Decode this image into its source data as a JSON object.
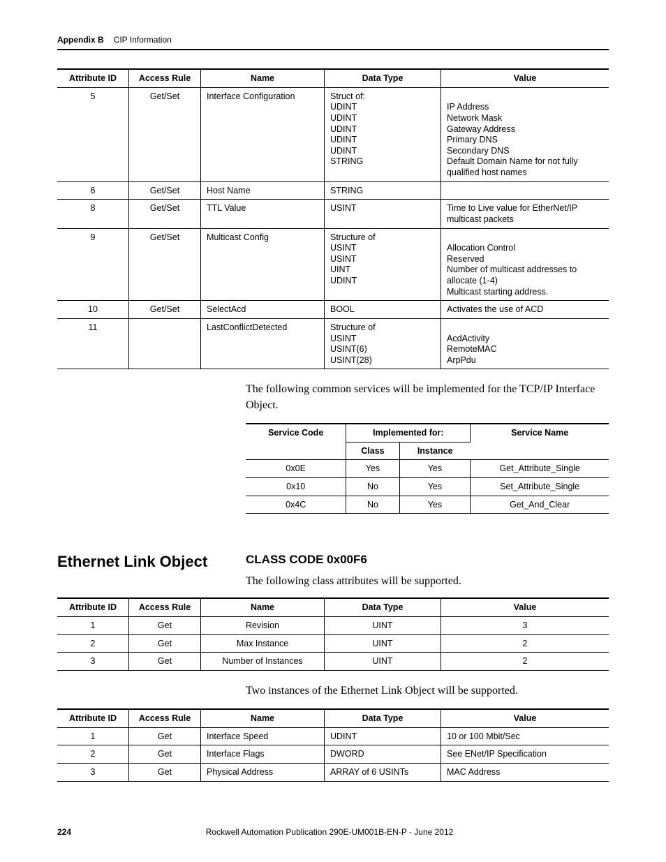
{
  "header": {
    "appendix": "Appendix B",
    "title": "CIP Information"
  },
  "table1": {
    "headers": [
      "Attribute ID",
      "Access Rule",
      "Name",
      "Data Type",
      "Value"
    ],
    "rows": [
      {
        "id": "5",
        "access": "Get/Set",
        "name": "Interface Configuration",
        "dtype": "Struct of:\nUDINT\nUDINT\nUDINT\nUDINT\nUDINT\nSTRING",
        "value": "\nIP Address\nNetwork Mask\nGateway Address\nPrimary DNS\nSecondary DNS\nDefault Domain Name for not fully qualified host names"
      },
      {
        "id": "6",
        "access": "Get/Set",
        "name": "Host Name",
        "dtype": "STRING",
        "value": ""
      },
      {
        "id": "8",
        "access": "Get/Set",
        "name": "TTL Value",
        "dtype": "USINT",
        "value": "Time to Live value for EtherNet/IP multicast packets"
      },
      {
        "id": "9",
        "access": "Get/Set",
        "name": "Multicast Config",
        "dtype": "Structure of\nUSINT\nUSINT\nUINT\nUDINT",
        "value": "\nAllocation Control\nReserved\nNumber of multicast addresses to allocate (1-4)\nMulticast starting address."
      },
      {
        "id": "10",
        "access": "Get/Set",
        "name": "SelectAcd",
        "dtype": "BOOL",
        "value": "Activates the use of ACD"
      },
      {
        "id": "11",
        "access": "",
        "name": "LastConflictDetected",
        "dtype": "Structure of\nUSINT\nUSINT(6)\nUSINT(28)",
        "value": "\nAcdActivity\nRemoteMAC\nArpPdu"
      }
    ]
  },
  "para1": "The following common services will be implemented for the TCP/IP Interface Object.",
  "table2": {
    "group": "Implemented for:",
    "headers": [
      "Service Code",
      "Class",
      "Instance",
      "Service Name"
    ],
    "rows": [
      {
        "code": "0x0E",
        "class": "Yes",
        "inst": "Yes",
        "name": "Get_Attribute_Single"
      },
      {
        "code": "0x10",
        "class": "No",
        "inst": "Yes",
        "name": "Set_Attribute_Single"
      },
      {
        "code": "0x4C",
        "class": "No",
        "inst": "Yes",
        "name": "Get_And_Clear"
      }
    ]
  },
  "section": {
    "side": "Ethernet Link Object",
    "subtitle": "CLASS CODE 0x00F6",
    "para": "The following class attributes will be supported."
  },
  "table3": {
    "headers": [
      "Attribute ID",
      "Access Rule",
      "Name",
      "Data Type",
      "Value"
    ],
    "rows": [
      {
        "id": "1",
        "access": "Get",
        "name": "Revision",
        "dtype": "UINT",
        "value": "3"
      },
      {
        "id": "2",
        "access": "Get",
        "name": "Max Instance",
        "dtype": "UINT",
        "value": "2"
      },
      {
        "id": "3",
        "access": "Get",
        "name": "Number of Instances",
        "dtype": "UINT",
        "value": "2"
      }
    ]
  },
  "para2": "Two instances of the Ethernet Link Object will be supported.",
  "table4": {
    "headers": [
      "Attribute ID",
      "Access Rule",
      "Name",
      "Data Type",
      "Value"
    ],
    "rows": [
      {
        "id": "1",
        "access": "Get",
        "name": "Interface Speed",
        "dtype": "UDINT",
        "value": "10 or 100 Mbit/Sec"
      },
      {
        "id": "2",
        "access": "Get",
        "name": "Interface Flags",
        "dtype": "DWORD",
        "value": "See ENet/IP Specification"
      },
      {
        "id": "3",
        "access": "Get",
        "name": "Physical Address",
        "dtype": "ARRAY of 6 USINTs",
        "value": "MAC Address"
      }
    ]
  },
  "footer": {
    "page": "224",
    "pub": "Rockwell Automation Publication 290E-UM001B-EN-P - June 2012"
  }
}
